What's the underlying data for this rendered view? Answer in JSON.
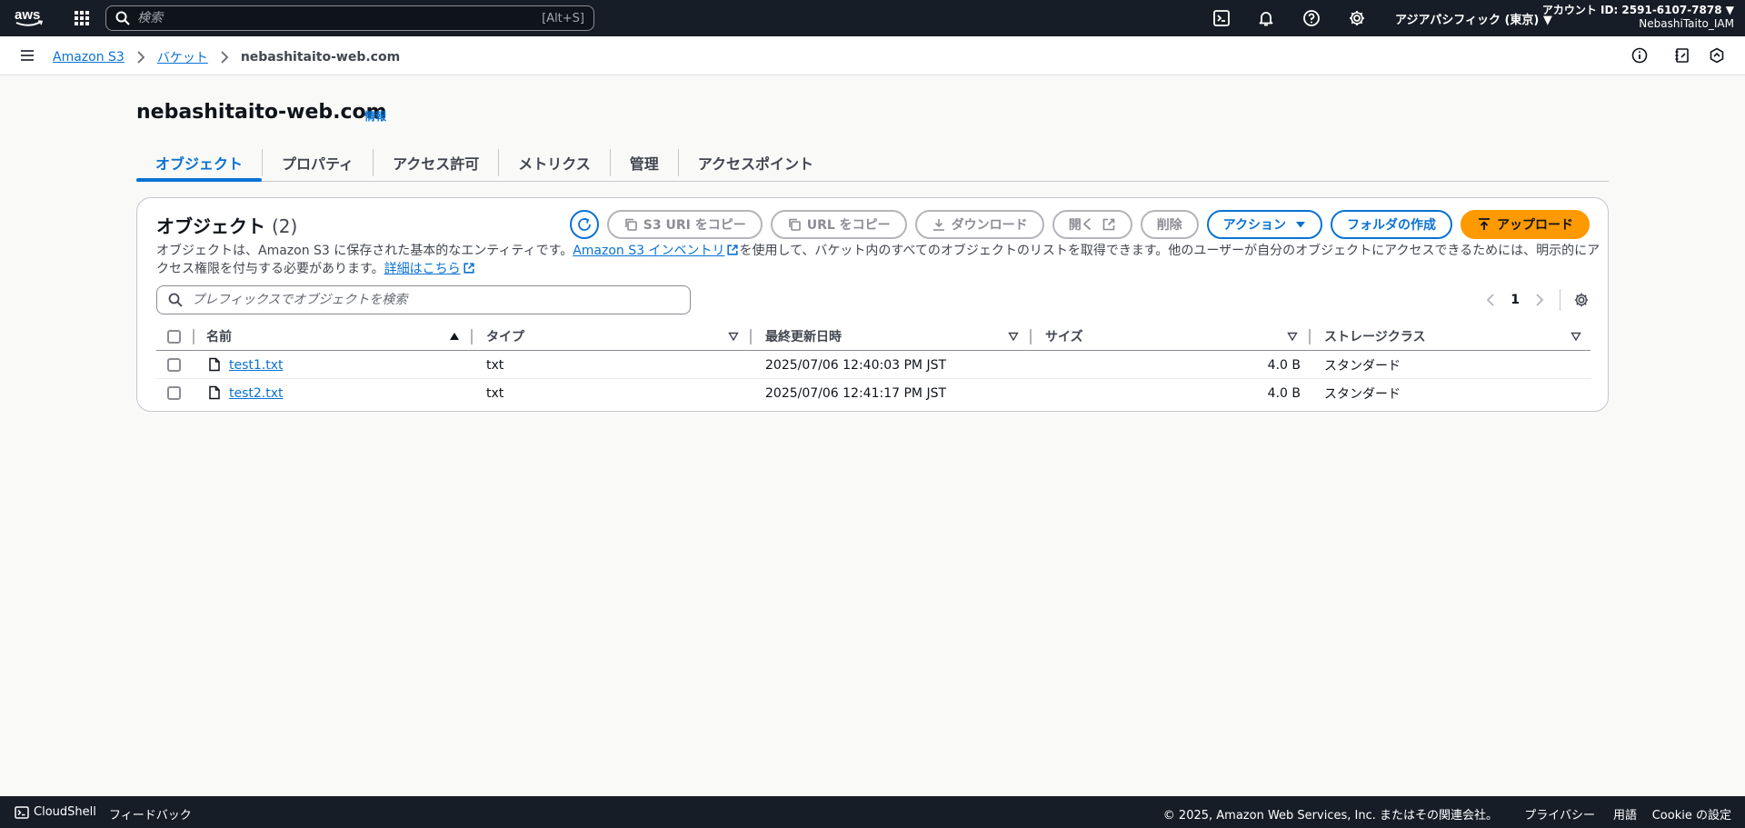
{
  "topnav": {
    "search_placeholder": "検索",
    "search_shortcut": "[Alt+S]",
    "region": "アジアパシフィック (東京) ▼",
    "account_id": "アカウント ID: 2591-6107-7878 ▼",
    "account_user": "NebashiTaito_IAM"
  },
  "breadcrumb": {
    "items": [
      "Amazon S3",
      "バケット"
    ],
    "current": "nebashitaito-web.com"
  },
  "header": {
    "title": "nebashitaito-web.com",
    "info": "情報"
  },
  "tabs": [
    "オブジェクト",
    "プロパティ",
    "アクセス許可",
    "メトリクス",
    "管理",
    "アクセスポイント"
  ],
  "objects": {
    "title": "オブジェクト",
    "count": "(2)",
    "buttons": {
      "copy_s3_uri": "S3 URI をコピー",
      "copy_url": "URL をコピー",
      "download": "ダウンロード",
      "open": "開く",
      "delete": "削除",
      "actions": "アクション",
      "create_folder": "フォルダの作成",
      "upload": "アップロード"
    },
    "desc_part1": "オブジェクトは、Amazon S3 に保存された基本的なエンティティです。",
    "desc_link1": "Amazon S3 インベントリ",
    "desc_part2": "を使用して、バケット内のすべてのオブジェクトのリストを取得できます。他のユーザーが自分のオブジェクトにアクセスできるためには、明示的にアクセス権限を付与する必要があります。",
    "desc_link2": "詳細はこちら",
    "filter_placeholder": "プレフィックスでオブジェクトを検索",
    "page": "1",
    "columns": [
      "名前",
      "タイプ",
      "最終更新日時",
      "サイズ",
      "ストレージクラス"
    ],
    "rows": [
      {
        "name": "test1.txt",
        "type": "txt",
        "modified": "2025/07/06 12:40:03 PM JST",
        "size": "4.0 B",
        "storage": "スタンダード"
      },
      {
        "name": "test2.txt",
        "type": "txt",
        "modified": "2025/07/06 12:41:17 PM JST",
        "size": "4.0 B",
        "storage": "スタンダード"
      }
    ]
  },
  "footer": {
    "cloudshell": "CloudShell",
    "feedback": "フィードバック",
    "copyright": "© 2025, Amazon Web Services, Inc. またはその関連会社。",
    "privacy": "プライバシー",
    "terms": "用語",
    "cookie": "Cookie の設定"
  },
  "colors": {
    "nav_bg": "#161d26",
    "link": "#0972d3",
    "upload": "#ff9900"
  }
}
